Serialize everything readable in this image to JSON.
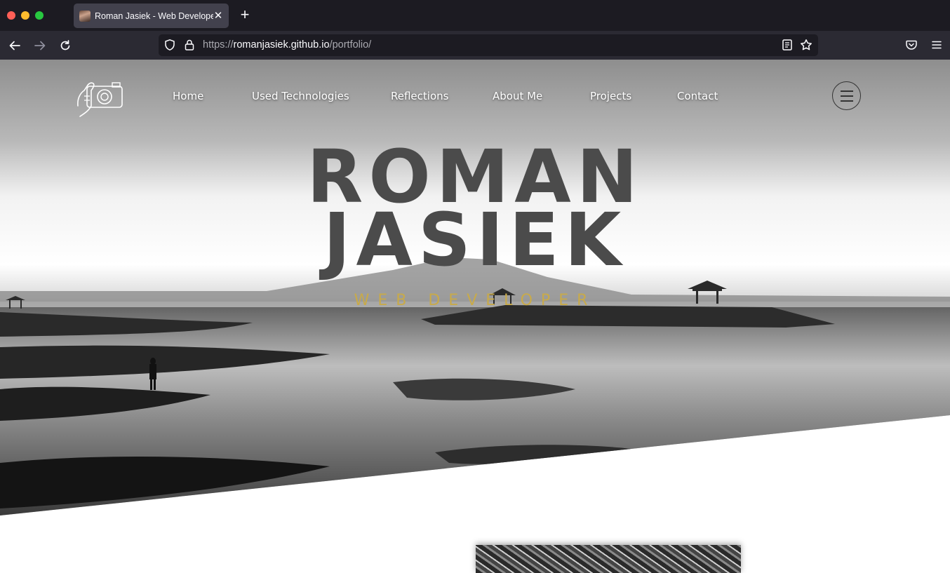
{
  "browser": {
    "tab_title": "Roman Jasiek - Web Developer",
    "tab_close_icon": "close-icon",
    "new_tab_icon": "plus-icon",
    "url_prefix": "https://",
    "url_host": "romanjasiek.github.io",
    "url_path": "/portfolio/",
    "icons": [
      "back-arrow-icon",
      "forward-arrow-icon",
      "reload-icon",
      "shield-icon",
      "lock-icon",
      "reader-view-icon",
      "bookmark-star-icon",
      "pocket-icon",
      "hamburger-menu-icon"
    ]
  },
  "site": {
    "logo_icon": "camera-hand-icon",
    "nav": [
      {
        "label": "Home"
      },
      {
        "label": "Used Technologies"
      },
      {
        "label": "Reflections"
      },
      {
        "label": "About Me"
      },
      {
        "label": "Projects"
      },
      {
        "label": "Contact"
      }
    ],
    "menu_icon": "hamburger-menu-icon",
    "hero": {
      "title_line1": "ROMAN",
      "title_line2": "JASIEK",
      "subtitle": "WEB DEVELOPER"
    }
  },
  "colors": {
    "title": "#4b4b4b",
    "subtitle_accent": "#c8aa4a",
    "chrome_dark": "#1c1b22",
    "chrome_toolbar": "#2b2a33"
  }
}
